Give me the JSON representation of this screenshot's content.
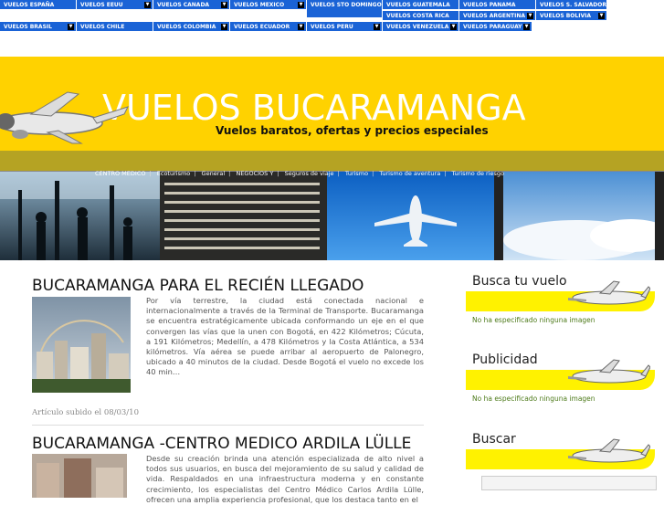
{
  "topnav": [
    {
      "label": "VUELOS ESPAÑA",
      "dropdown": false
    },
    {
      "label": "VUELOS EEUU",
      "dropdown": true
    },
    {
      "label": "VUELOS CANADA",
      "dropdown": true
    },
    {
      "label": "VUELOS MEXICO",
      "dropdown": true
    },
    {
      "label": "VUELOS STO DOMINGO",
      "dropdown": false
    },
    {
      "label": "VUELOS GUATEMALA",
      "dropdown": false
    },
    {
      "label": "VUELOS PANAMA",
      "dropdown": false
    },
    {
      "label": "VUELOS S. SALVADOR",
      "dropdown": false
    },
    {
      "label": "VUELOS COSTA RICA",
      "dropdown": false
    },
    {
      "label": "VUELOS ARGENTINA",
      "dropdown": true
    },
    {
      "label": "VUELOS BOLIVIA",
      "dropdown": true
    },
    {
      "label": "VUELOS BRASIL",
      "dropdown": true
    },
    {
      "label": "VUELOS CHILE",
      "dropdown": false
    },
    {
      "label": "VUELOS COLOMBIA",
      "dropdown": true
    },
    {
      "label": "VUELOS ECUADOR",
      "dropdown": true
    },
    {
      "label": "VUELOS PERU",
      "dropdown": true
    },
    {
      "label": "VUELOS VENEZUELA",
      "dropdown": true
    },
    {
      "label": "VUELOS PARAGUAY",
      "dropdown": true
    }
  ],
  "banner": {
    "title": "VUELOS BUCARAMANGA",
    "subtitle": "Vuelos baratos, ofertas y precios especiales"
  },
  "catnav": [
    "CENTRO MEDICO",
    "Ecoturismo",
    "General",
    "NEGOCIOS Y",
    "Seguros de viaje",
    "Turismo",
    "Turismo de aventura",
    "Turismo de riesgo"
  ],
  "articles": [
    {
      "title": "BUCARAMANGA PARA EL RECIÉN LLEGADO",
      "text": "Por vía terrestre, la ciudad está conectada nacional e internacionalmente a través de la Terminal de Transporte. Bucaramanga se encuentra estratégicamente ubicada conformando un eje en el que convergen las vías que la unen con Bogotá, en 422 Kilómetros; Cúcuta, a 191 Kilómetros; Medellín, a 478 Kilómetros y la Costa Atlántica, a 534 kilómetros. Vía aérea se puede arribar al aeropuerto de Palonegro, ubicado a 40 minutos de la ciudad. Desde Bogotá el vuelo no excede los 40 min…",
      "meta": "Artículo subido el 08/03/10"
    },
    {
      "title": "BUCARAMANGA -CENTRO MEDICO ARDILA LÜLLE",
      "text": "Desde su creación brinda una atención especializada de alto nivel a todos sus usuarios, en busca del mejoramiento de su salud y calidad de vida. Respaldados en una infraestructura moderna y en constante crecimiento, los especialistas del Centro Médico Carlos Ardila Lülle, ofrecen una amplia experiencia profesional, que los destaca tanto en el"
    }
  ],
  "sidebar": [
    {
      "title": "Busca tu vuelo",
      "note": "No ha especificado ninguna imagen"
    },
    {
      "title": "Publicidad",
      "note": "No ha especificado ninguna imagen"
    },
    {
      "title": "Buscar"
    }
  ],
  "colors": {
    "nav": "#1a63d6",
    "banner": "#ffd200",
    "band": "#fff200"
  }
}
